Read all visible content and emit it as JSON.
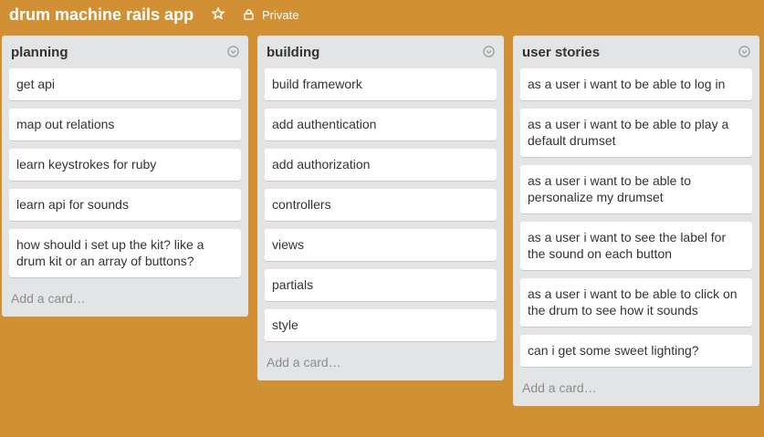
{
  "board": {
    "title": "drum machine rails app",
    "visibility": "Private",
    "star_icon": "star-icon",
    "lock_icon": "lock-icon",
    "background_color": "#d29034"
  },
  "lists": [
    {
      "title": "planning",
      "cards": [
        "get api",
        "map out relations",
        "learn keystrokes for ruby",
        "learn api for sounds",
        "how should i set up the kit? like a drum kit or an array of buttons?"
      ],
      "add_card_label": "Add a card…"
    },
    {
      "title": "building",
      "cards": [
        "build framework",
        "add authentication",
        "add authorization",
        "controllers",
        "views",
        "partials",
        "style"
      ],
      "add_card_label": "Add a card…"
    },
    {
      "title": "user stories",
      "cards": [
        "as a user i want to be able to log in",
        "as a user i want to be able to play a default drumset",
        "as a user i want to be able to personalize my drumset",
        "as a user i want to see the label for the sound on each button",
        "as a user i want to be able to click on the drum to see how it sounds",
        "can i get some sweet lighting?"
      ],
      "add_card_label": "Add a card…"
    }
  ]
}
